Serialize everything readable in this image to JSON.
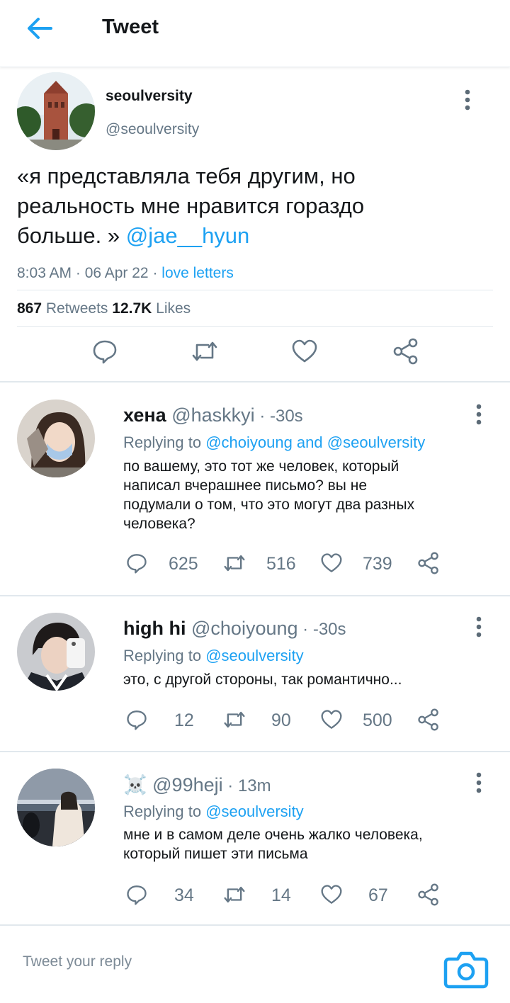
{
  "header": {
    "title": "Tweet"
  },
  "tweet": {
    "name": "seoulversity",
    "handle": "@seoulversity",
    "text_line1": "«я представляла тебя другим, но",
    "text_line2": "реальность мне нравится гораздо",
    "text_line3_prefix": "больше. » ",
    "mention": "@jae__hyun",
    "time": "8:03 AM · 06 Apr 22 · ",
    "source": "love letters",
    "retweets_count": "867",
    "retweets_label": " Retweets ",
    "likes_count": "12.7K",
    "likes_label": " Likes"
  },
  "replies": [
    {
      "name": "хена",
      "handle": "@haskkyi",
      "time": " · -30s",
      "replying_prefix": "Replying to ",
      "replying_to": "@choiyoung and @seoulversity",
      "text": [
        "по вашему, это тот же человек, который",
        "написал вчерашнее письмо? вы не",
        "подумали о том, что это могут два разных",
        "человека?"
      ],
      "comments": "625",
      "retweets": "516",
      "likes": "739"
    },
    {
      "name": "high hi",
      "handle": "@choiyoung",
      "time": " · -30s",
      "replying_prefix": "Replying to ",
      "replying_to": "@seoulversity",
      "text": [
        "это, с другой стороны, так романтично..."
      ],
      "comments": "12",
      "retweets": "90",
      "likes": "500"
    },
    {
      "name": "☠️",
      "handle": "@99heji",
      "time": " · 13m",
      "replying_prefix": "Replying to ",
      "replying_to": "@seoulversity",
      "text": [
        "мне и в самом деле очень жалко человека,",
        "который пишет эти письма"
      ],
      "comments": "34",
      "retweets": "14",
      "likes": "67"
    }
  ],
  "composer": {
    "placeholder": "Tweet your reply"
  },
  "colors": {
    "accent": "#1da1f2",
    "muted": "#657786",
    "text": "#14171a",
    "divider": "#e1e8ed"
  },
  "icons": [
    "back-arrow-icon",
    "more-icon",
    "reply-icon",
    "retweet-icon",
    "like-icon",
    "share-icon",
    "camera-icon"
  ]
}
